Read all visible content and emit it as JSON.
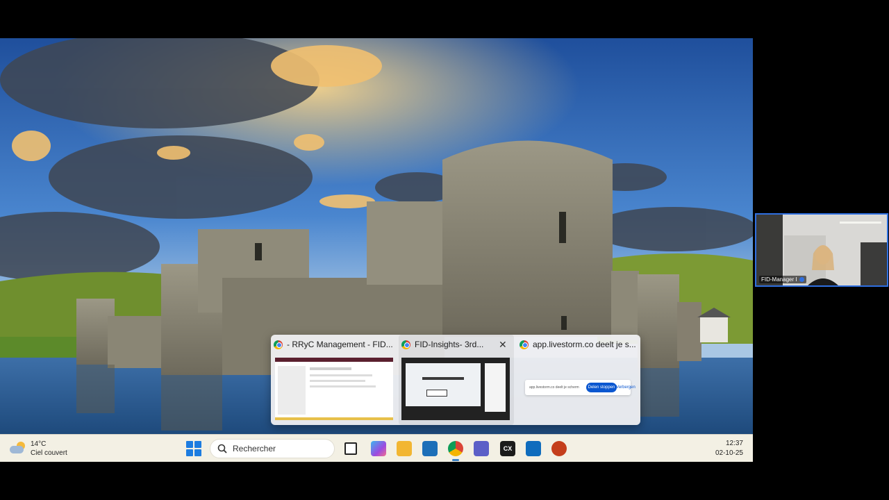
{
  "window_previews": [
    {
      "title": "- RRyC Management - FID...",
      "browser_icon": "chrome-icon"
    },
    {
      "title": "FID-Insights- 3rd...",
      "browser_icon": "chrome-icon",
      "close_icon": "✕"
    },
    {
      "title": "app.livestorm.co deelt je s...",
      "browser_icon": "chrome-icon",
      "share_bar": {
        "message": "app.livestorm.co deelt je scherm",
        "stop_label": "Delen stoppen",
        "hide_label": "Verbergen"
      }
    }
  ],
  "taskbar": {
    "weather": {
      "temp": "14°C",
      "condition": "Ciel couvert",
      "icon": "cloud-sun-icon"
    },
    "search_placeholder": "Rechercher",
    "apps": [
      {
        "name": "task-view-icon",
        "color": "#222222"
      },
      {
        "name": "copilot-icon",
        "color": "#7b4ae0"
      },
      {
        "name": "file-explorer-icon",
        "color": "#f2b632"
      },
      {
        "name": "store-icon",
        "color": "#1d6fb8"
      },
      {
        "name": "chrome-icon",
        "color": "#db4437"
      },
      {
        "name": "teams-icon",
        "color": "#5b5fc7"
      },
      {
        "name": "cx-app-icon",
        "color": "#1b1b1b"
      },
      {
        "name": "outlook-icon",
        "color": "#0f6cbd"
      },
      {
        "name": "powerpoint-icon",
        "color": "#c43e1c"
      }
    ],
    "time": "12:37",
    "date": "02-10-25"
  },
  "webcam": {
    "participant": "FID-Manager I"
  },
  "colors": {
    "accent": "#2f6fe0",
    "taskbar_bg": "#f3f0e4"
  }
}
